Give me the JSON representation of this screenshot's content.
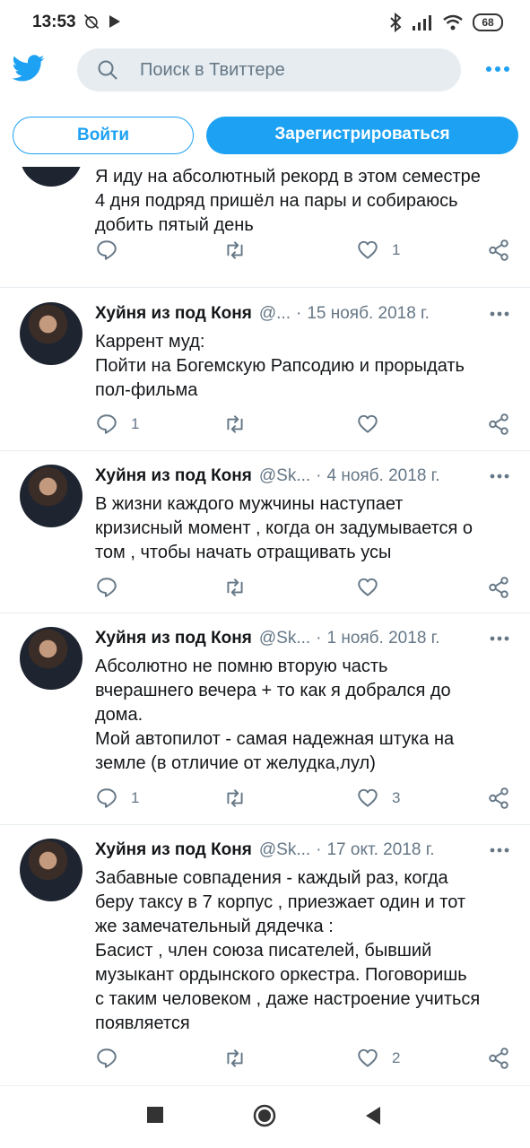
{
  "status_bar": {
    "time": "13:53",
    "battery": "68"
  },
  "topbar": {
    "search_placeholder": "Поиск в Твиттере"
  },
  "auth": {
    "login_label": "Войти",
    "signup_label": "Зарегистрироваться"
  },
  "tweets": [
    {
      "name": "",
      "handle": "",
      "date": "",
      "lines": [
        "Я иду на абсолютный рекорд в этом семестре",
        "4 дня подряд пришёл на пары и собираюсь",
        "добить пятый день"
      ],
      "replies": "",
      "likes": "1"
    },
    {
      "name": "Хуйня из под Коня",
      "handle": "@...",
      "date": "15 нояб. 2018 г.",
      "lines": [
        "Каррент муд:",
        "Пойти на Богемскую Рапсодию и прорыдать",
        "пол-фильма"
      ],
      "replies": "1",
      "likes": ""
    },
    {
      "name": "Хуйня из под Коня",
      "handle": "@Sk...",
      "date": "4 нояб. 2018 г.",
      "lines": [
        "В жизни каждого мужчины наступает",
        "кризисный момент , когда он задумывается о",
        "том , чтобы начать отращивать усы"
      ],
      "replies": "",
      "likes": ""
    },
    {
      "name": "Хуйня из под Коня",
      "handle": "@Sk...",
      "date": "1 нояб. 2018 г.",
      "lines": [
        "Абсолютно не помню вторую часть",
        "вчерашнего вечера + то как я добрался до",
        "дома.",
        "Мой автопилот - самая надежная штука на",
        "земле (в отличие от желудка,лул)"
      ],
      "replies": "1",
      "likes": "3"
    },
    {
      "name": "Хуйня из под Коня",
      "handle": "@Sk...",
      "date": "17 окт. 2018 г.",
      "lines": [
        "Забавные совпадения - каждый раз, когда",
        "беру таксу в 7 корпус , приезжает один и тот",
        "же замечательный дядечка :",
        "Басист , член союза писателей, бывший",
        "музыкант ордынского оркестра. Поговоришь",
        "с таким человеком , даже настроение учиться",
        "появляется"
      ],
      "replies": "",
      "likes": "2"
    }
  ],
  "colors": {
    "accent": "#1da1f2",
    "secondary_text": "#657786",
    "icon": "#657786"
  }
}
